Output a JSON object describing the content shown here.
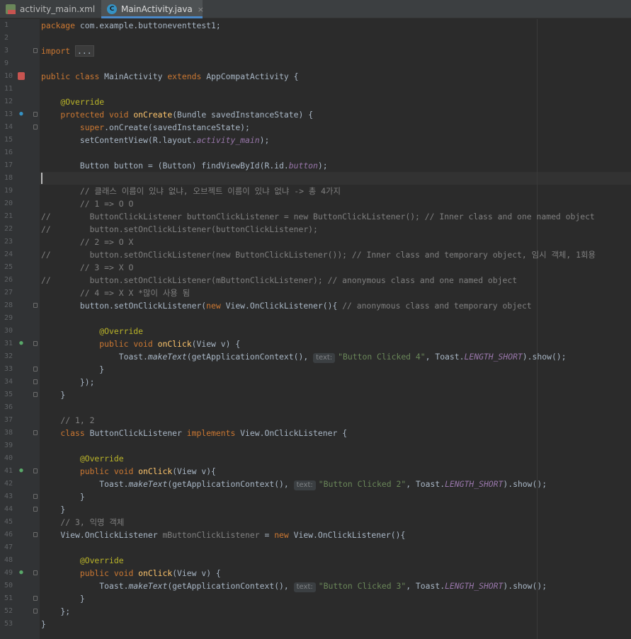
{
  "tabs": [
    {
      "label": "activity_main.xml",
      "close": "×",
      "icon": "xml-file-icon"
    },
    {
      "label": "MainActivity.java",
      "close": "×",
      "icon": "java-class-icon",
      "active": true
    }
  ],
  "editor": {
    "accent": "#4a88c7",
    "caret_line": 18,
    "lines": {
      "l1_pkg": "package",
      "l1_name": " com.example.buttoneventtest1;",
      "l3_import": "import",
      "l3_fold": "...",
      "l10_public": "public",
      "l10_class": "class",
      "l10_name": " MainActivity ",
      "l10_extends": "extends",
      "l10_parent": " AppCompatActivity {",
      "l12_anno": "    @Override",
      "l13_protected": "    protected",
      "l13_void": "void",
      "l13_fn": "onCreate",
      "l13_rest": "(Bundle savedInstanceState) {",
      "l14_super": "        super",
      "l14_rest": ".onCreate(savedInstanceState);",
      "l15_pre": "        setContentView(R.layout.",
      "l15_field": "activity_main",
      "l15_post": ");",
      "l17_pre": "        Button button = (Button) findViewById(R.id.",
      "l17_field": "button",
      "l17_post": ");",
      "l19": "        // 클래스 이름이 있냐 없냐, 오브젝트 이름이 있냐 없냐 -> 총 4가지",
      "l20": "        // 1 => O O",
      "l21": "//        ButtonClickListener buttonClickListener = new ButtonClickListener(); // Inner class and one named object",
      "l22": "//        button.setOnClickListener(buttonClickListener);",
      "l23": "        // 2 => O X",
      "l24": "//        button.setOnClickListener(new ButtonClickListener()); // Inner class and temporary object, 임시 객체, 1회용",
      "l25": "        // 3 => X O",
      "l26": "//        button.setOnClickListener(mButtonClickListener); // anonymous class and one named object",
      "l27": "        // 4 => X X *많이 사용 됨",
      "l28_pre": "        button.setOnClickListener(",
      "l28_new": "new",
      "l28_mid": " View.OnClickListener(){ ",
      "l28_cm": "// anonymous class and temporary object",
      "l30_anno": "            @Override",
      "l31_public": "            public",
      "l31_void": "void",
      "l31_fn": "onClick",
      "l31_rest": "(View v) {",
      "l32_pre": "                Toast.",
      "l32_method": "makeText",
      "l32_mid": "(getApplicationContext(), ",
      "hint_text": "text:",
      "l32_str": "\"Button Clicked 4\"",
      "l32_mid2": ", Toast.",
      "l32_field": "LENGTH_SHORT",
      "l32_post": ").show();",
      "l33": "            }",
      "l34": "        });",
      "l35": "    }",
      "l37": "    // 1, 2",
      "l38_class": "    class",
      "l38_name": " ButtonClickListener ",
      "l38_impl": "implements",
      "l38_rest": " View.OnClickListener {",
      "l40_anno": "        @Override",
      "l41_public": "        public",
      "l41_void": "void",
      "l41_fn": "onClick",
      "l41_rest": "(View v){",
      "l42_pre": "            Toast.",
      "l42_method": "makeText",
      "l42_mid": "(getApplicationContext(), ",
      "l42_str": "\"Button Clicked 2\"",
      "l42_mid2": ", Toast.",
      "l42_field": "LENGTH_SHORT",
      "l42_post": ").show();",
      "l43": "        }",
      "l44": "    }",
      "l45": "    // 3, 익명 객체",
      "l46_pre": "    View.OnClickListener ",
      "l46_var": "mButtonClickListener",
      "l46_mid": " = ",
      "l46_new": "new",
      "l46_post": " View.OnClickListener(){",
      "l48_anno": "        @Override",
      "l49_public": "        public",
      "l49_void": "void",
      "l49_fn": "onClick",
      "l49_rest": "(View v) {",
      "l50_pre": "            Toast.",
      "l50_method": "makeText",
      "l50_mid": "(getApplicationContext(), ",
      "l50_str": "\"Button Clicked 3\"",
      "l50_mid2": ", Toast.",
      "l50_field": "LENGTH_SHORT",
      "l50_post": ").show();",
      "l51": "        }",
      "l52": "    };",
      "l53": "}"
    }
  }
}
